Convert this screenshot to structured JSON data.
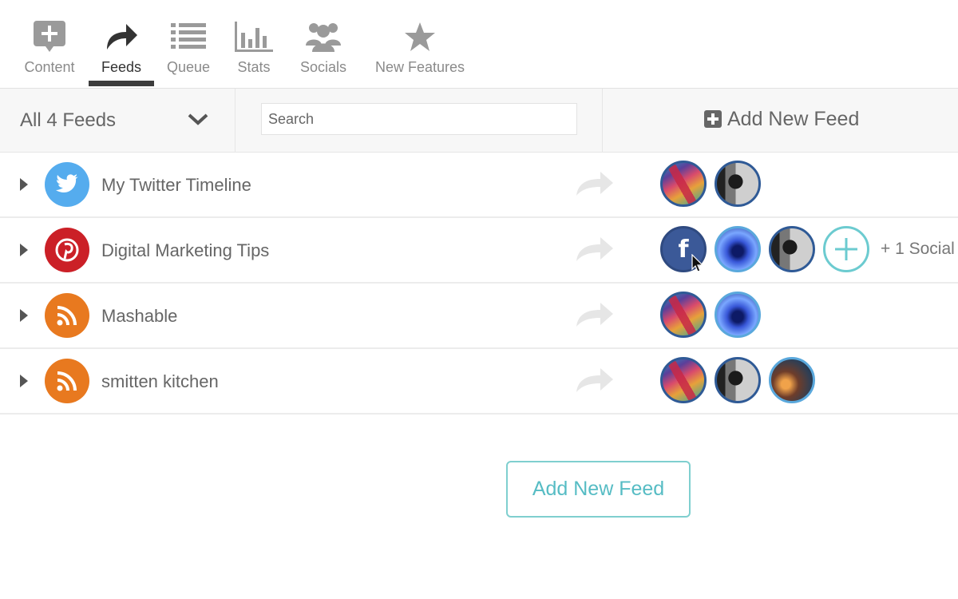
{
  "nav": {
    "items": [
      {
        "label": "Content",
        "icon": "content-plus-icon"
      },
      {
        "label": "Feeds",
        "icon": "share-arrow-icon",
        "active": true
      },
      {
        "label": "Queue",
        "icon": "list-icon"
      },
      {
        "label": "Stats",
        "icon": "bar-chart-icon"
      },
      {
        "label": "Socials",
        "icon": "people-icon"
      },
      {
        "label": "New Features",
        "icon": "star-icon"
      }
    ]
  },
  "toolbar": {
    "filter_label": "All 4 Feeds",
    "search_placeholder": "Search",
    "add_feed_label": "Add New Feed"
  },
  "feeds": [
    {
      "name": "My Twitter Timeline",
      "source": "twitter",
      "color": "#55acee",
      "socials": [
        "colorful",
        "photo-dark"
      ]
    },
    {
      "name": "Digital Marketing Tips",
      "source": "pinterest",
      "color": "#cb2027",
      "socials": [
        "facebook",
        "blue-glow",
        "photo-dark"
      ],
      "has_add": true,
      "more_label": "+ 1 Social"
    },
    {
      "name": "Mashable",
      "source": "rss",
      "color": "#e8791f",
      "socials": [
        "colorful",
        "blue-glow"
      ]
    },
    {
      "name": "smitten kitchen",
      "source": "rss",
      "color": "#e8791f",
      "socials": [
        "colorful",
        "photo-dark",
        "warm-light"
      ]
    }
  ],
  "bottom_button_label": "Add New Feed",
  "colors": {
    "accent": "#56bcc4",
    "facebook": "#3b5998",
    "text": "#666666"
  }
}
